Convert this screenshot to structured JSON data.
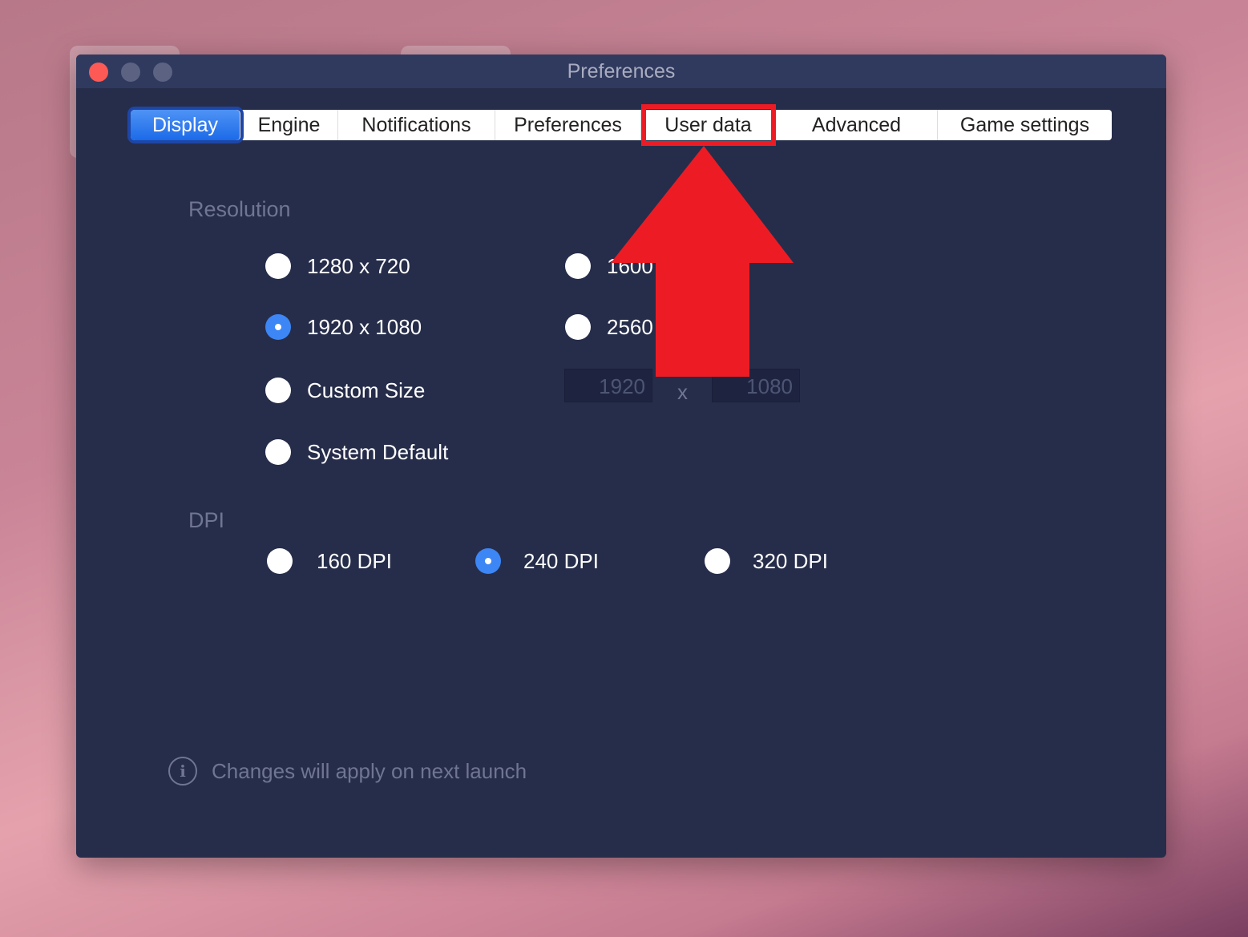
{
  "window": {
    "title": "Preferences"
  },
  "tabs": [
    {
      "label": "Display",
      "active": true
    },
    {
      "label": "Engine"
    },
    {
      "label": "Notifications"
    },
    {
      "label": "Preferences"
    },
    {
      "label": "User data"
    },
    {
      "label": "Advanced"
    },
    {
      "label": "Game settings"
    }
  ],
  "resolution": {
    "label": "Resolution",
    "options": [
      {
        "label": "1280 x 720",
        "selected": false
      },
      {
        "label": "1600",
        "selected": false
      },
      {
        "label": "1920 x 1080",
        "selected": true
      },
      {
        "label": "2560",
        "selected": false
      },
      {
        "label": "Custom Size",
        "selected": false
      },
      {
        "label": "System Default",
        "selected": false
      }
    ],
    "custom_width": "1920",
    "custom_sep": "x",
    "custom_height": "1080"
  },
  "dpi": {
    "label": "DPI",
    "options": [
      {
        "label": "160 DPI",
        "selected": false
      },
      {
        "label": "240 DPI",
        "selected": true
      },
      {
        "label": "320 DPI",
        "selected": false
      }
    ]
  },
  "footer": {
    "note": "Changes will apply on next launch",
    "icon": "info-icon"
  },
  "annotation": {
    "color": "#ed1c24",
    "target": "User data"
  }
}
